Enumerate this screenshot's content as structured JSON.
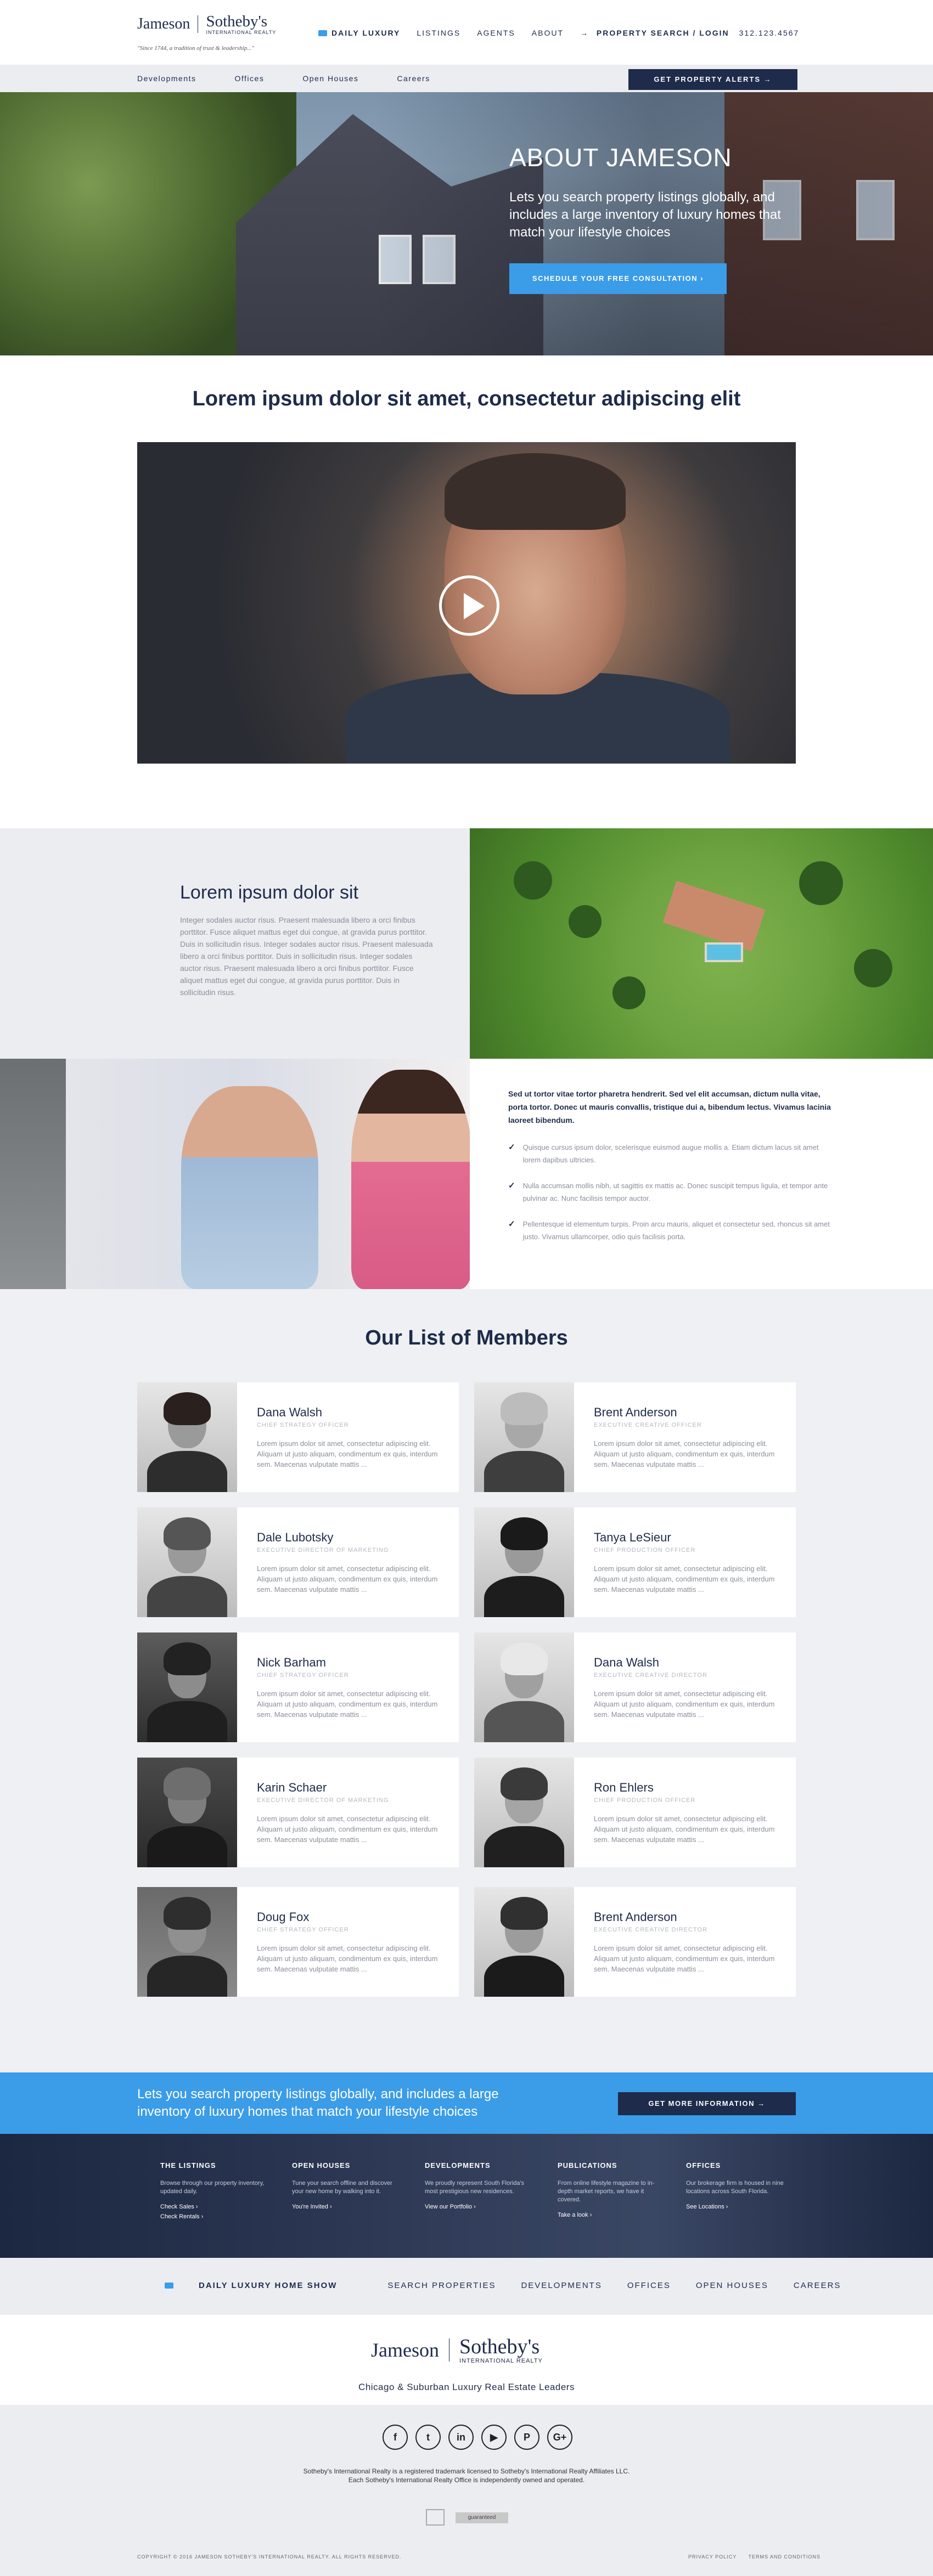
{
  "header": {
    "logo_left": "Jameson",
    "logo_right": "Sotheby's",
    "logo_sub": "INTERNATIONAL REALTY",
    "tagline": "\"Since 1744, a tradition of trust & leadership...\"",
    "nav": {
      "daily": "DAILY LUXURY",
      "listings": "LISTINGS",
      "agents": "AGENTS",
      "about": "ABOUT",
      "search": "PROPERTY SEARCH / LOGIN",
      "phone": "312.123.4567"
    }
  },
  "subnav": {
    "items": [
      "Developments",
      "Offices",
      "Open Houses",
      "Careers"
    ],
    "alert_button": "GET PROPERTY ALERTS →"
  },
  "hero": {
    "title": "ABOUT JAMESON",
    "text": "Lets you search property listings globally, and includes a large inventory of luxury homes that match your lifestyle choices",
    "cta": "SCHEDULE YOUR FREE CONSULTATION ›"
  },
  "intro": {
    "title": "Lorem ipsum dolor sit amet, consectetur adipiscing elit"
  },
  "about1": {
    "title": "Lorem ipsum dolor sit",
    "text": "Integer sodales auctor risus. Praesent malesuada libero a orci finibus porttitor. Fusce aliquet mattus eget dui congue, at gravida purus porttitor. Duis in sollicitudin risus. Integer sodales auctor risus. Praesent malesuada libero a orci finibus porttitor. Duis in sollicitudin risus. Integer sodales auctor risus. Praesent malesuada libero a orci finibus porttitor. Fusce aliquet mattus eget dui congue, at gravida purus porttitor. Duis in sollicitudin risus."
  },
  "about2": {
    "lead": "Sed ut tortor vitae tortor pharetra hendrerit. Sed vel elit accumsan, dictum nulla vitae, porta tortor. Donec ut mauris convallis, tristique dui a, bibendum lectus. Vivamus lacinia laoreet bibendum.",
    "bullets": [
      "Quisque cursus ipsum dolor, scelerisque euismod augue mollis a. Etiam dictum lacus sit amet lorem dapibus ultricies.",
      "Nulla accumsan mollis nibh, ut sagittis ex mattis ac. Donec suscipit tempus ligula, et tempor ante pulvinar ac. Nunc facilisis tempor auctor.",
      "Pellentesque id elementum turpis. Proin arcu mauris, aliquet et consectetur sed, rhoncus sit amet justo. Vivamus ullamcorper, odio quis facilisis porta."
    ]
  },
  "members": {
    "title": "Our List of Members",
    "bio": "Lorem ipsum dolor sit amet, consectetur adipiscing elit. Aliquam ut justo aliquam, condimentum ex quis, interdum sem. Maecenas vulputate mattis ...",
    "list": [
      {
        "name": "Dana Walsh",
        "role": "CHIEF STRATEGY OFFICER"
      },
      {
        "name": "Brent Anderson",
        "role": "EXECUTIVE CREATIVE OFFICER"
      },
      {
        "name": "Dale Lubotsky",
        "role": "EXECUTIVE DIRECTOR OF MARKETING"
      },
      {
        "name": "Tanya LeSieur",
        "role": "CHIEF PRODUCTION OFFICER"
      },
      {
        "name": "Nick Barham",
        "role": "CHIEF STRATEGY OFFICER"
      },
      {
        "name": "Dana Walsh",
        "role": "EXECUTIVE CREATIVE DIRECTOR"
      },
      {
        "name": "Karin Schaer",
        "role": "EXECUTIVE DIRECTOR OF MARKETING"
      },
      {
        "name": "Ron Ehlers",
        "role": "CHIEF PRODUCTION OFFICER"
      },
      {
        "name": "Doug Fox",
        "role": "CHIEF STRATEGY OFFICER"
      },
      {
        "name": "Brent Anderson",
        "role": "EXECUTIVE CREATIVE DIRECTOR"
      }
    ]
  },
  "band": {
    "text": "Lets you search property listings globally, and includes a large inventory of luxury homes that match your lifestyle choices",
    "button": "GET MORE INFORMATION →"
  },
  "footer_cols": [
    {
      "title": "THE LISTINGS",
      "text": "Browse through our property inventory, updated daily.",
      "links": [
        "Check Sales ›",
        "Check Rentals ›"
      ]
    },
    {
      "title": "OPEN HOUSES",
      "text": "Tune your search offline and discover your new home by walking into it.",
      "links": [
        "You're Invited ›"
      ]
    },
    {
      "title": "DEVELOPMENTS",
      "text": "We proudly represent South Florida's most prestigious new residences.",
      "links": [
        "View our Portfolio ›"
      ]
    },
    {
      "title": "PUBLICATIONS",
      "text": "From online lifestyle magazine to in-depth market reports, we have it covered.",
      "links": [
        "Take a look ›"
      ]
    },
    {
      "title": "OFFICES",
      "text": "Our brokerage firm is housed in nine locations across South Florida.",
      "links": [
        "See Locations ›"
      ]
    }
  ],
  "bottom_nav": {
    "daily": "DAILY LUXURY HOME SHOW",
    "items": [
      "SEARCH PROPERTIES",
      "DEVELOPMENTS",
      "OFFICES",
      "OPEN HOUSES",
      "CAREERS"
    ]
  },
  "brand": {
    "logo_left": "Jameson",
    "logo_right": "Sotheby's",
    "logo_sub": "INTERNATIONAL REALTY",
    "subtitle": "Chicago & Suburban Luxury Real Estate Leaders"
  },
  "legal": {
    "social": [
      "f",
      "t",
      "in",
      "▶",
      "P",
      "G+"
    ],
    "line1": "Sotheby's International Realty is a registered trademark licensed to Sotheby's International Realty Affiliates LLC.",
    "line2": "Each Sotheby's International Realty Office is independently owned and operated.",
    "badge": "guaranteed",
    "copyright": "COPYRIGHT © 2016 JAMESON SOTHEBY'S INTERNATIONAL REALTY. ALL RIGHTS RESERVED.",
    "privacy": "PRIVACY POLICY",
    "terms": "TERMS AND CONDITIONS"
  },
  "colors": {
    "navy": "#1e2b4a",
    "accent_blue": "#3b9ce8",
    "light_gray": "#ebedf1"
  }
}
